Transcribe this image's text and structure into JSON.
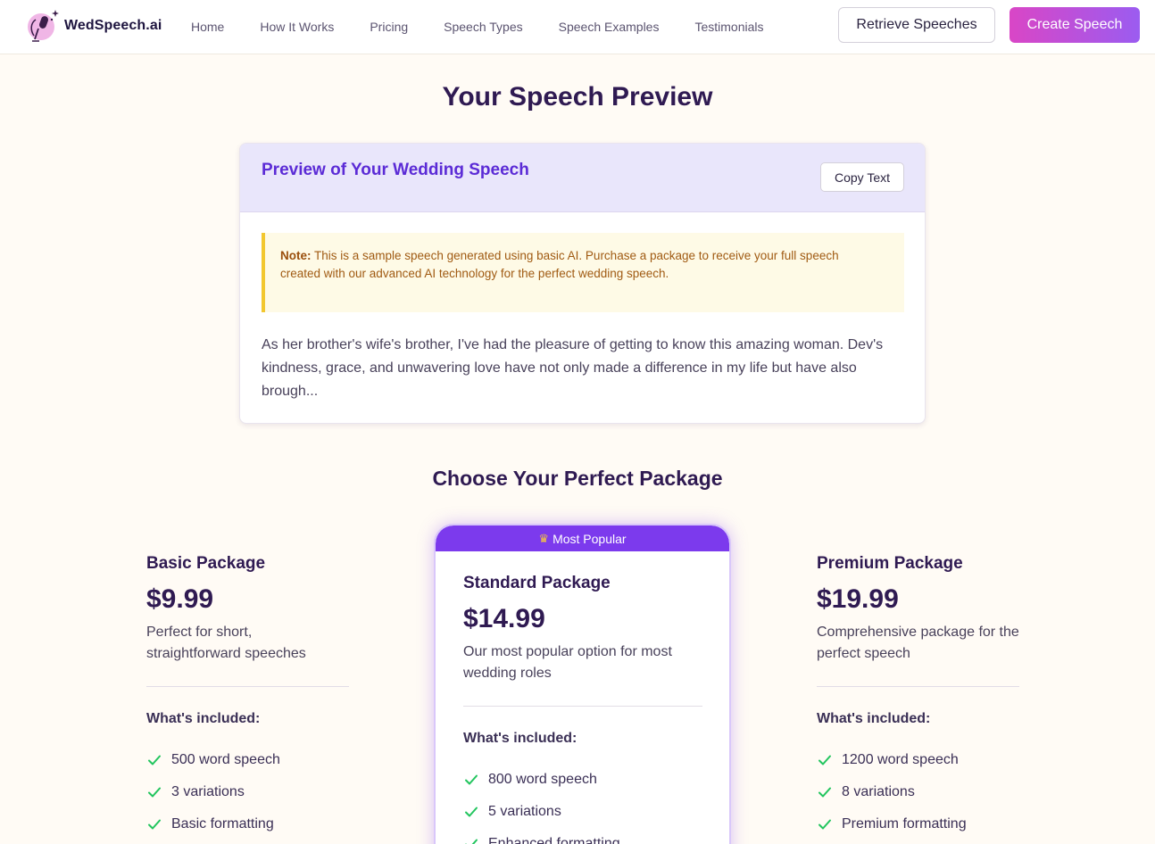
{
  "nav": {
    "brand": "WedSpeech.ai",
    "links": [
      "Home",
      "How It Works",
      "Pricing",
      "Speech Types",
      "Speech Examples",
      "Testimonials"
    ],
    "retrieve_label": "Retrieve Speeches",
    "create_label": "Create Speech"
  },
  "page": {
    "title": "Your Speech Preview"
  },
  "preview": {
    "title": "Preview of Your Wedding Speech",
    "copy_label": "Copy Text",
    "note_label": "Note:",
    "note_text": " This is a sample speech generated using basic AI. Purchase a package to receive your full speech created with our advanced AI technology for the perfect wedding speech.",
    "speech_text": "As her brother's wife's brother, I've had the pleasure of getting to know this amazing woman. Dev's kindness, grace, and unwavering love have not only made a difference in my life but have also brough..."
  },
  "packages": {
    "title": "Choose Your Perfect Package",
    "included_label": "What's included:",
    "popular_label": "Most Popular",
    "basic": {
      "name": "Basic Package",
      "price": "$9.99",
      "description": "Perfect for short, straightforward speeches",
      "features": [
        "500 word speech",
        "3 variations",
        "Basic formatting"
      ]
    },
    "standard": {
      "name": "Standard Package",
      "price": "$14.99",
      "description": "Our most popular option for most wedding roles",
      "features": [
        "800 word speech",
        "5 variations",
        "Enhanced formatting"
      ]
    },
    "premium": {
      "name": "Premium Package",
      "price": "$19.99",
      "description": "Comprehensive package for the perfect speech",
      "features": [
        "1200 word speech",
        "8 variations",
        "Premium formatting"
      ]
    }
  },
  "colors": {
    "accent": "#7c3aed",
    "preview_title": "#5b2bd6",
    "check": "#22c55e",
    "note_border": "#f2c730"
  },
  "icons": {
    "logo": "microphone-heart-icon",
    "feature": "check-icon",
    "badge": "crown-icon"
  }
}
